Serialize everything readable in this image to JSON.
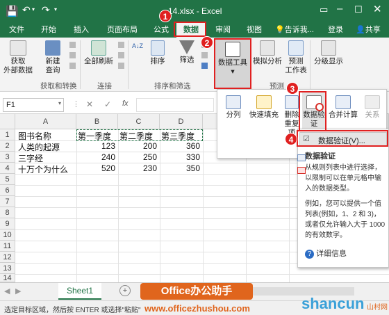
{
  "title": {
    "filename": "14.xlsx",
    "app": "Excel"
  },
  "tabs": [
    "文件",
    "开始",
    "插入",
    "页面布局",
    "公式",
    "数据",
    "审阅",
    "视图"
  ],
  "tell_me": "告诉我...",
  "login": "登录",
  "share": "共享",
  "ribbon": {
    "get_external": "获取\n外部数据",
    "new_query": "新建\n查询",
    "refresh_all": "全部刷新",
    "sort_az": "A↓Z",
    "sort": "排序",
    "filter": "筛选",
    "data_tools": "数据工具",
    "what_if": "模拟分析",
    "forecast_sheet": "预测\n工作表",
    "outline": "分级显示",
    "group_get_transform": "获取和转换",
    "group_connections": "连接",
    "group_sort_filter": "排序和筛选",
    "group_forecast": "预测"
  },
  "formula_bar": {
    "name_box": "F1",
    "fx": "fx"
  },
  "columns": [
    "A",
    "B",
    "C",
    "D"
  ],
  "rows": [
    "1",
    "2",
    "3",
    "4",
    "5",
    "6",
    "7",
    "8",
    "9",
    "10",
    "11",
    "12",
    "13",
    "14"
  ],
  "table": [
    [
      "图书名称",
      "第一季度",
      "第二季度",
      "第三季度"
    ],
    [
      "人类的起源",
      "123",
      "200",
      "360"
    ],
    [
      "三字经",
      "240",
      "250",
      "330"
    ],
    [
      "十万个为什么",
      "520",
      "230",
      "350"
    ]
  ],
  "data_tools_menu": {
    "text_to_columns": "分列",
    "flash_fill": "快速填充",
    "remove_duplicates": "删除\n重复项",
    "data_validation": "数据验\n证",
    "consolidate": "合并计算",
    "relationships": "关系"
  },
  "validation_submenu": {
    "item": "数据验证(V)...",
    "tooltip_title": "数据验证",
    "tooltip_text1": "从规则列表中进行选择，以限制可以在单元格中输入的数据类型。",
    "tooltip_text2": "例如，您可以提供一个值列表(例如，1、2 和 3)，或者仅允许输入大于 1000 的有效数字。",
    "more_info": "详细信息"
  },
  "badges": [
    "1",
    "2",
    "3",
    "4"
  ],
  "sheet_tab": "Sheet1",
  "status_text": "选定目标区域，然后按 ENTER 或选择\"粘贴\"",
  "watermark": {
    "brand": "Office办公助手",
    "url": "www.officezhushou.com",
    "site": "shancun",
    "site_sub": "山村网"
  },
  "colors": {
    "excel_green": "#217346",
    "badge_red": "#e02020"
  }
}
